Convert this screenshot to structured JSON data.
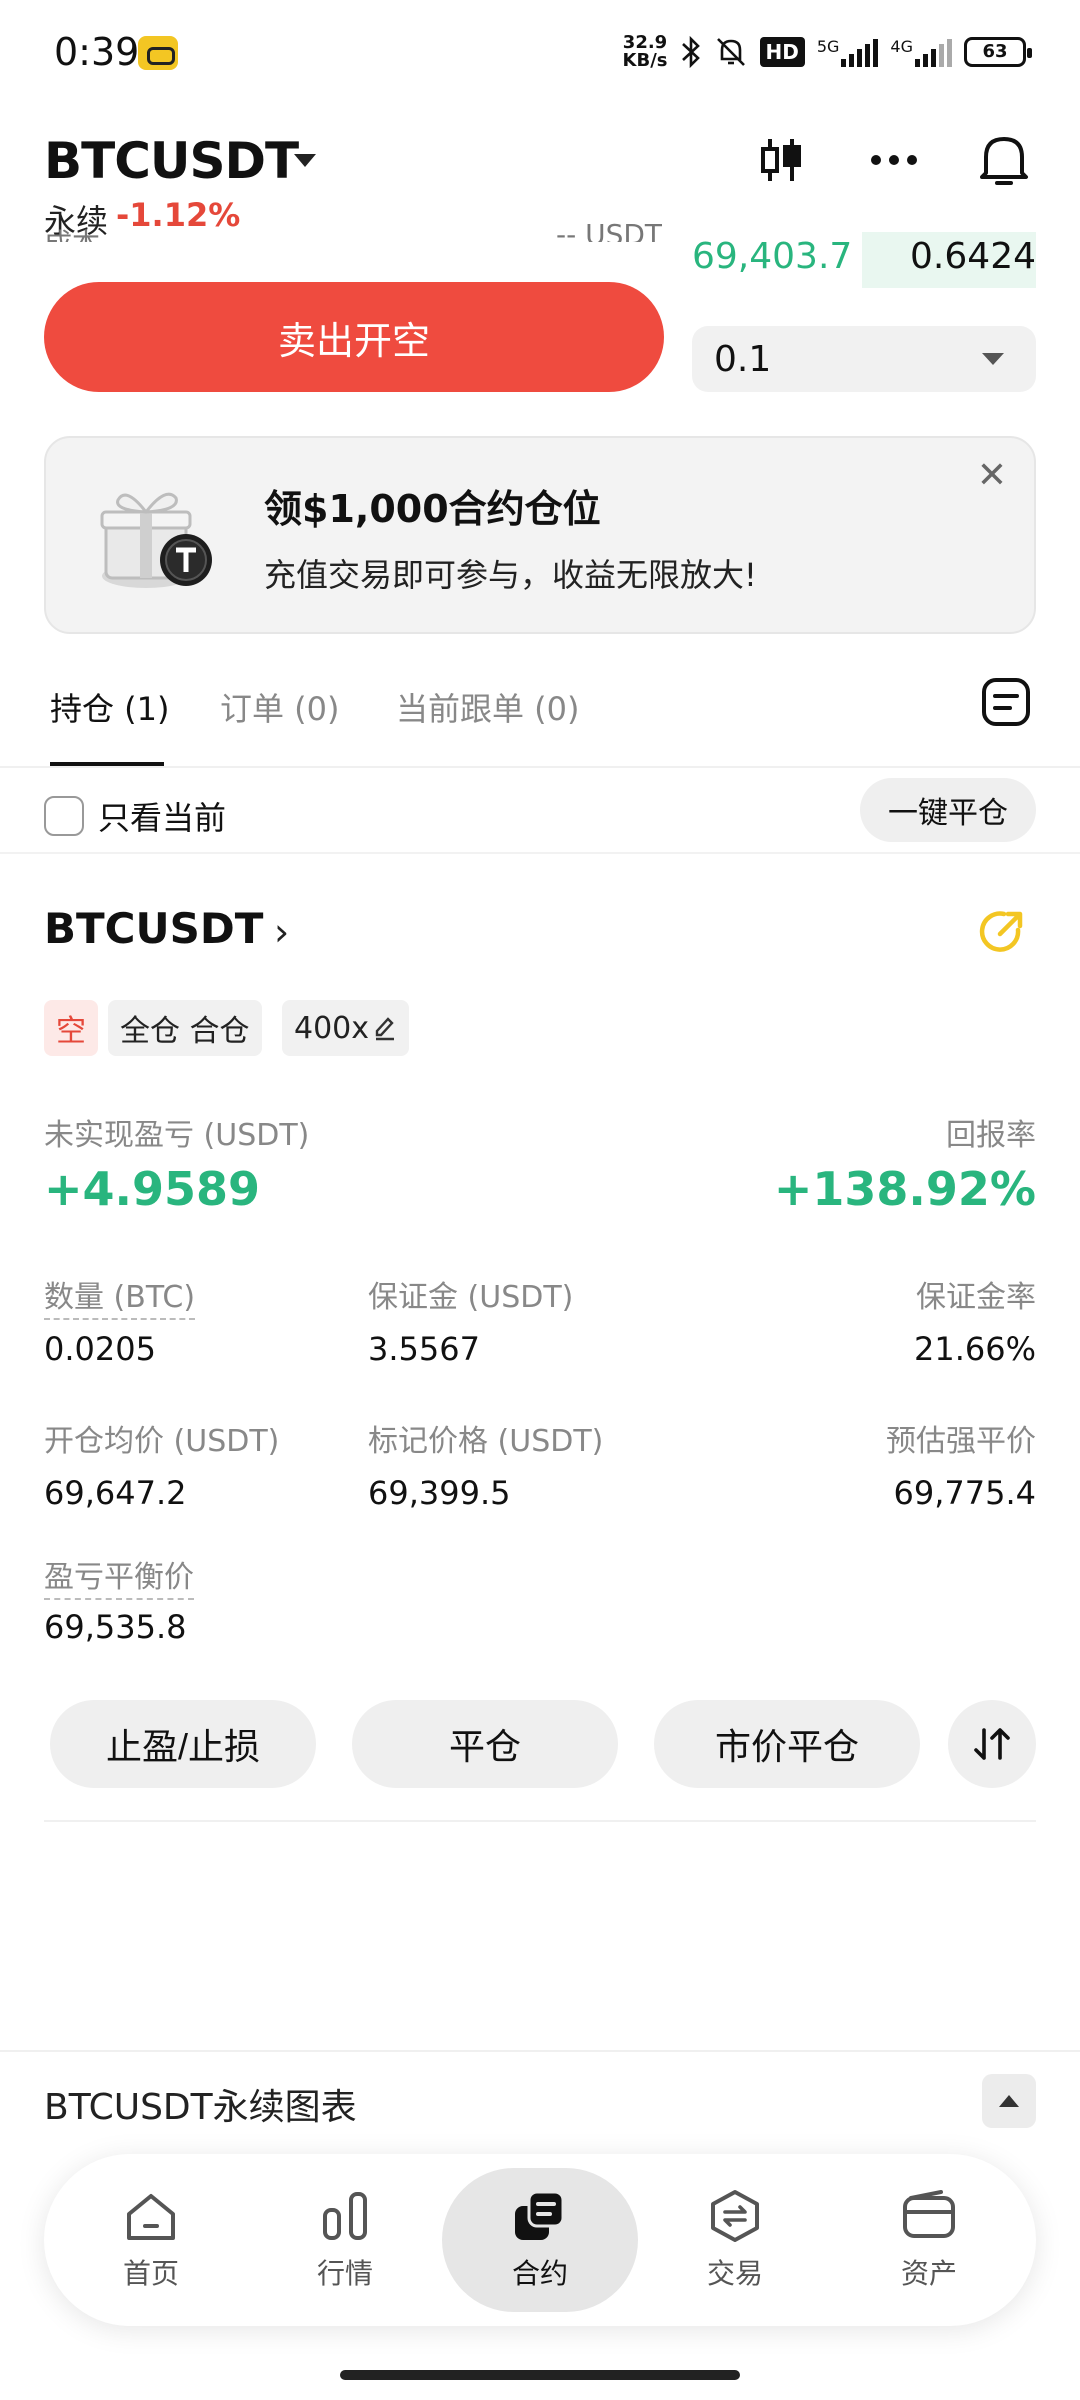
{
  "status_bar": {
    "time": "0:39",
    "net_speed_value": "32.9",
    "net_speed_unit": "KB/s",
    "hd_badge": "HD",
    "sim1": "5G",
    "sim2": "4G",
    "battery": "63",
    "icons": [
      "carrier-badge-icon",
      "bluetooth-icon",
      "bell-muted-icon",
      "signal-icon",
      "battery-icon"
    ]
  },
  "header": {
    "pair": "BTCUSDT",
    "perpetual_label": "永续",
    "change": "-1.12%",
    "icons": [
      "candlestick-icon",
      "more-icon",
      "bell-icon"
    ]
  },
  "order_book_row": {
    "cut_left": "成本",
    "cut_mid": "-- USDT",
    "price": "69,403.7",
    "qty": "0.6424"
  },
  "trade": {
    "sell_button": "卖出开空",
    "qty_value": "0.1"
  },
  "promo": {
    "title": "领$1,000合约仓位",
    "subtitle": "充值交易即可参与，收益无限放大!"
  },
  "tabs": [
    {
      "label": "持仓 (1)",
      "active": true
    },
    {
      "label": "订单 (0)",
      "active": false
    },
    {
      "label": "当前跟单 (0)",
      "active": false
    }
  ],
  "filter": {
    "only_current_label": "只看当前",
    "close_all_button": "一键平仓"
  },
  "position": {
    "pair": "BTCUSDT",
    "side_tag": "空",
    "margin_mode_tag": "全仓 合仓",
    "leverage_tag": "400x",
    "unrealized_pnl_label": "未实现盈亏 (USDT)",
    "unrealized_pnl_value": "+4.9589",
    "roe_label": "回报率",
    "roe_value": "+138.92%",
    "fields": [
      {
        "label": "数量 (BTC)",
        "value": "0.0205"
      },
      {
        "label": "保证金 (USDT)",
        "value": "3.5567"
      },
      {
        "label": "保证金率",
        "value": "21.66%"
      },
      {
        "label": "开仓均价 (USDT)",
        "value": "69,647.2"
      },
      {
        "label": "标记价格 (USDT)",
        "value": "69,399.5"
      },
      {
        "label": "预估强平价",
        "value": "69,775.4"
      },
      {
        "label": "盈亏平衡价",
        "value": "69,535.8"
      }
    ],
    "actions": [
      "止盈/止损",
      "平仓",
      "市价平仓"
    ]
  },
  "chart_section": {
    "title": "BTCUSDT永续图表"
  },
  "bottom_nav": [
    {
      "label": "首页",
      "icon": "home-icon",
      "active": false
    },
    {
      "label": "行情",
      "icon": "market-icon",
      "active": false
    },
    {
      "label": "合约",
      "icon": "futures-icon",
      "active": true
    },
    {
      "label": "交易",
      "icon": "trade-icon",
      "active": false
    },
    {
      "label": "资产",
      "icon": "wallet-icon",
      "active": false
    }
  ],
  "colors": {
    "sell_red": "#ef4b3f",
    "profit_green": "#29b57e",
    "loss_red": "#e5483a",
    "share_yellow": "#f3c623"
  }
}
